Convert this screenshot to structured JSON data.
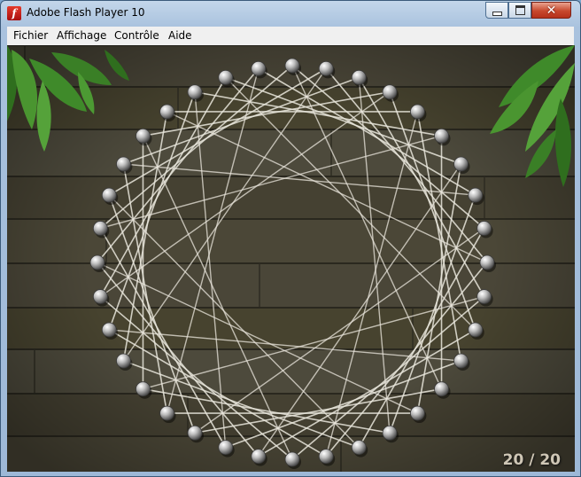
{
  "window": {
    "title": "Adobe Flash Player 10",
    "icon": "flash-player-icon",
    "controls": [
      "minimize-icon",
      "maximize-icon",
      "close-icon"
    ]
  },
  "menu": {
    "items": [
      "Fichier",
      "Affichage",
      "Contrôle",
      "Aide"
    ]
  },
  "game": {
    "counter": "20 / 20",
    "peg_count": 36,
    "colors": {
      "wood": "#4a4638",
      "thread": "#e9e6dc",
      "peg": "#c9c9c9",
      "leaf": "#3f8a2a",
      "counter_text": "#cfc7b6"
    }
  }
}
